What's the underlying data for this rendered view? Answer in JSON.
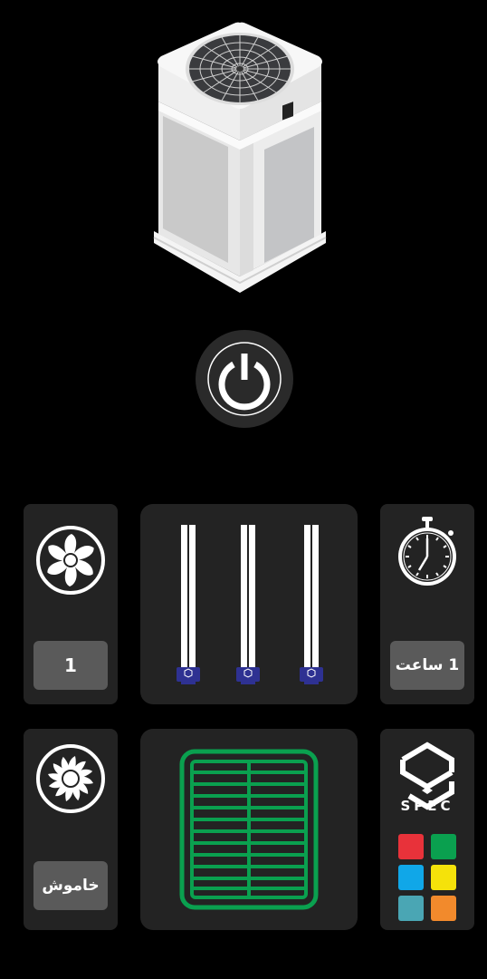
{
  "device": {
    "name": "air-purifier"
  },
  "power": {
    "icon": "power-icon",
    "state": "off"
  },
  "fan_speed": {
    "icon": "fan-icon",
    "value": "1"
  },
  "uv_lamps": {
    "icon": "uv-lamp-icon",
    "count": 3,
    "lamp_badge": "SPEC"
  },
  "timer": {
    "icon": "stopwatch-icon",
    "value": "1 ساعت"
  },
  "turbo_fan": {
    "icon": "turbo-fan-icon",
    "value": "خاموش"
  },
  "filter": {
    "icon": "filter-grille-icon",
    "color": "#0aa04f"
  },
  "brand": {
    "logo_text": "SPEC",
    "colors": [
      "#e8323a",
      "#0aa04f",
      "#10a7e8",
      "#f5e20a",
      "#4aa6b4",
      "#f28a2c"
    ]
  }
}
